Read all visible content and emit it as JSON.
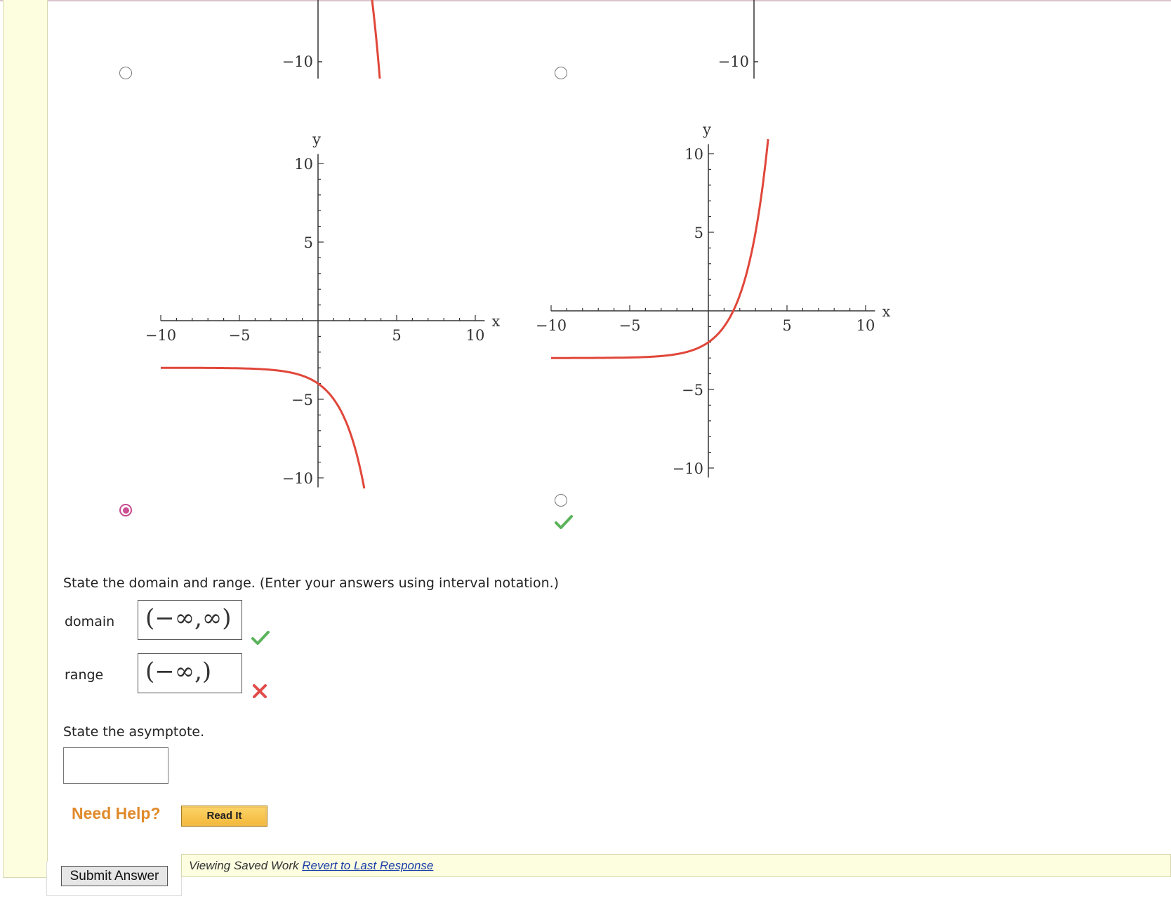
{
  "colors": {
    "curve": "#e0473a",
    "check": "#5bb35b",
    "cross": "#e24a4a",
    "help": "#e08a2a",
    "link": "#1a3fa8"
  },
  "top_graphs": [
    {
      "y_tick": "−10"
    },
    {
      "y_tick": "−10"
    }
  ],
  "graphs": [
    {
      "x_label": "x",
      "y_label": "y",
      "x_ticks": [
        "−10",
        "−5",
        "5",
        "10"
      ],
      "y_ticks": [
        "10",
        "5",
        "−5",
        "−10"
      ],
      "selected": true
    },
    {
      "x_label": "x",
      "y_label": "y",
      "x_ticks": [
        "−10",
        "−5",
        "5",
        "10"
      ],
      "y_ticks": [
        "10",
        "5",
        "−5",
        "−10"
      ],
      "selected": false,
      "marked_correct": true
    }
  ],
  "chart_data": [
    {
      "type": "line",
      "series": [
        {
          "function": "y = -3 - 2^x",
          "x": [
            -10,
            -5,
            -2,
            0,
            1,
            2,
            3,
            3.2
          ],
          "y": [
            -3,
            -3.03,
            -3.25,
            -4,
            -5,
            -7,
            -11,
            -12.2
          ]
        }
      ],
      "xlabel": "x",
      "ylabel": "y",
      "xlim": [
        -11,
        11
      ],
      "ylim": [
        -11,
        11
      ],
      "grid": false
    },
    {
      "type": "line",
      "series": [
        {
          "function": "y = 2^x - 3",
          "x": [
            -10,
            -5,
            -2,
            0,
            1,
            2,
            3,
            3.8
          ],
          "y": [
            -3,
            -2.97,
            -2.75,
            -2,
            -1,
            1,
            5,
            10.9
          ]
        }
      ],
      "xlabel": "x",
      "ylabel": "y",
      "xlim": [
        -11,
        11
      ],
      "ylim": [
        -11,
        11
      ],
      "grid": false
    }
  ],
  "prompt_domain_range": "State the domain and range. (Enter your answers using interval notation.)",
  "domain": {
    "label": "domain",
    "value": "(−∞,∞)"
  },
  "range": {
    "label": "range",
    "value": "(−∞,)"
  },
  "prompt_asymptote": "State the asymptote.",
  "asymptote": {
    "value": ""
  },
  "need_help": "Need Help?",
  "read_it": "Read It",
  "submit": "Submit Answer",
  "saved_text": "Viewing Saved Work",
  "revert_link": "Revert to Last Response"
}
